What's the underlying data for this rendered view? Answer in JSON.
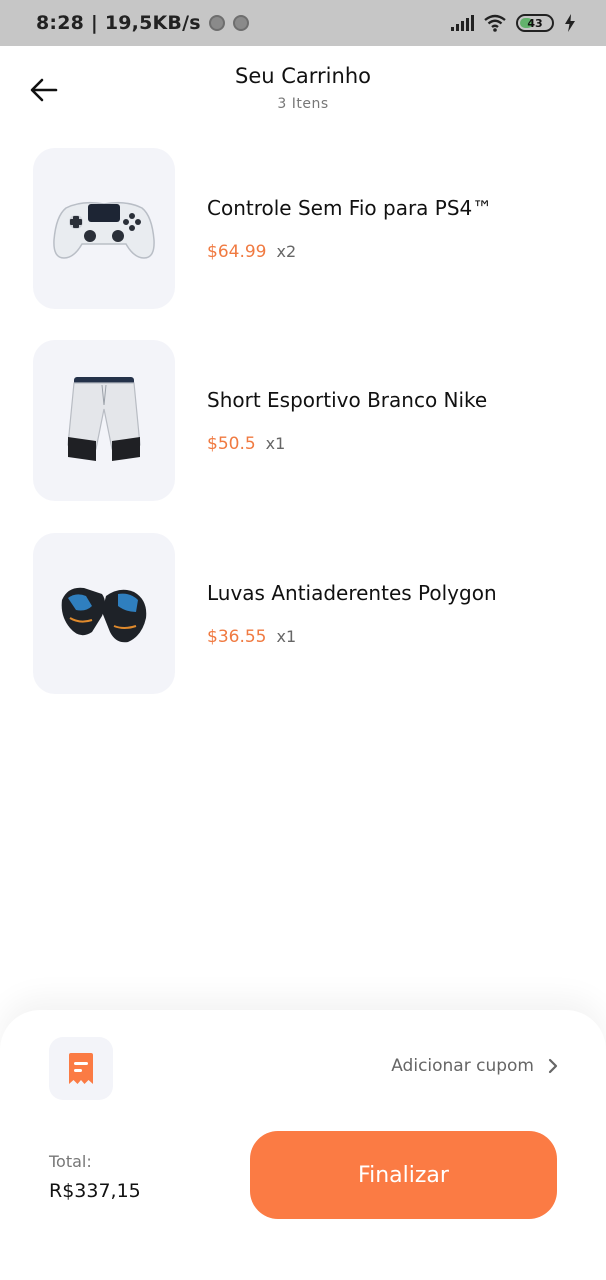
{
  "status_bar": {
    "time": "8:28 | 19,5KB/s",
    "battery": "43",
    "battery_level": 0.43
  },
  "header": {
    "back_icon": "arrow-left-icon",
    "title": "Seu Carrinho",
    "subtitle": "3 Itens"
  },
  "cart": {
    "items": [
      {
        "name": "Controle Sem Fio para PS4™",
        "price": "$64.99",
        "qty": "x2",
        "image": "ps4-controller"
      },
      {
        "name": "Short Esportivo Branco Nike",
        "price": "$50.5",
        "qty": "x1",
        "image": "sport-shorts"
      },
      {
        "name": "Luvas Antiaderentes Polygon",
        "price": "$36.55",
        "qty": "x1",
        "image": "gloves"
      }
    ]
  },
  "footer": {
    "coupon_icon": "receipt-icon",
    "coupon_label": "Adicionar cupom",
    "total_label": "Total:",
    "total_value": "R$337,15",
    "checkout_label": "Finalizar"
  },
  "colors": {
    "accent": "#fb7b44",
    "price": "#f07a41",
    "thumb_bg": "#f3f4f9",
    "status_bar_bg": "#c6c6c6"
  }
}
